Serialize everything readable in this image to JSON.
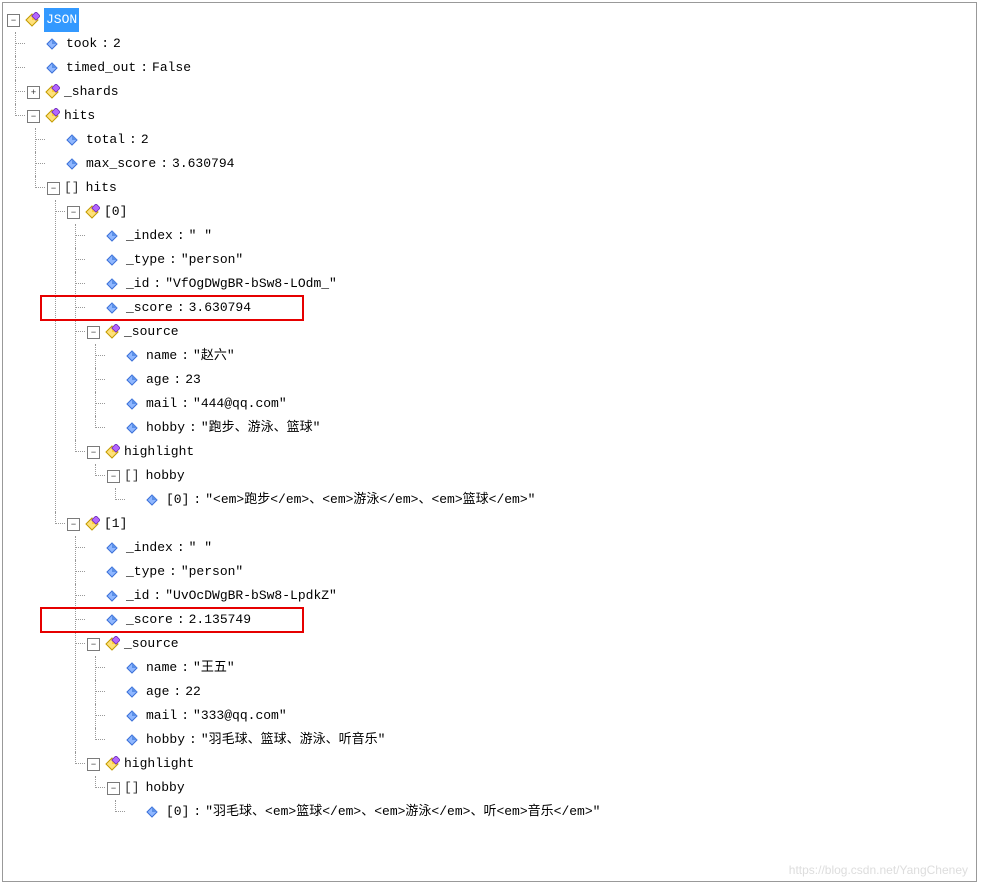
{
  "root_label": "JSON",
  "took": {
    "key": "took",
    "value": "2"
  },
  "timed_out": {
    "key": "timed_out",
    "value": "False"
  },
  "shards": {
    "key": "_shards"
  },
  "hits": {
    "key": "hits",
    "total": {
      "key": "total",
      "value": "2"
    },
    "max_score": {
      "key": "max_score",
      "value": "3.630794"
    },
    "hits_array": {
      "label": "hits",
      "brackets": "[]",
      "items": [
        {
          "idx": "[0]",
          "index": {
            "key": "_index",
            "value": "\"       \""
          },
          "type": {
            "key": "_type",
            "value": "\"person\""
          },
          "id": {
            "key": "_id",
            "value": "\"VfOgDWgBR-bSw8-LOdm_\""
          },
          "score": {
            "key": "_score",
            "value": "3.630794"
          },
          "source": {
            "key": "_source",
            "name": {
              "key": "name",
              "value": "\"赵六\""
            },
            "age": {
              "key": "age",
              "value": "23"
            },
            "mail": {
              "key": "mail",
              "value": "\"444@qq.com\""
            },
            "hobby": {
              "key": "hobby",
              "value": "\"跑步、游泳、篮球\""
            }
          },
          "highlight": {
            "key": "highlight",
            "hobby_arr": {
              "label": "hobby",
              "brackets": "[]",
              "item0_key": "[0]",
              "item0_value": "\"<em>跑步</em>、<em>游泳</em>、<em>篮球</em>\""
            }
          }
        },
        {
          "idx": "[1]",
          "index": {
            "key": "_index",
            "value": "\"       \""
          },
          "type": {
            "key": "_type",
            "value": "\"person\""
          },
          "id": {
            "key": "_id",
            "value": "\"UvOcDWgBR-bSw8-LpdkZ\""
          },
          "score": {
            "key": "_score",
            "value": "2.135749"
          },
          "source": {
            "key": "_source",
            "name": {
              "key": "name",
              "value": "\"王五\""
            },
            "age": {
              "key": "age",
              "value": "22"
            },
            "mail": {
              "key": "mail",
              "value": "\"333@qq.com\""
            },
            "hobby": {
              "key": "hobby",
              "value": "\"羽毛球、篮球、游泳、听音乐\""
            }
          },
          "highlight": {
            "key": "highlight",
            "hobby_arr": {
              "label": "hobby",
              "brackets": "[]",
              "item0_key": "[0]",
              "item0_value": "\"羽毛球、<em>篮球</em>、<em>游泳</em>、听<em>音乐</em>\""
            }
          }
        }
      ]
    }
  },
  "watermark": "https://blog.csdn.net/YangCheney"
}
